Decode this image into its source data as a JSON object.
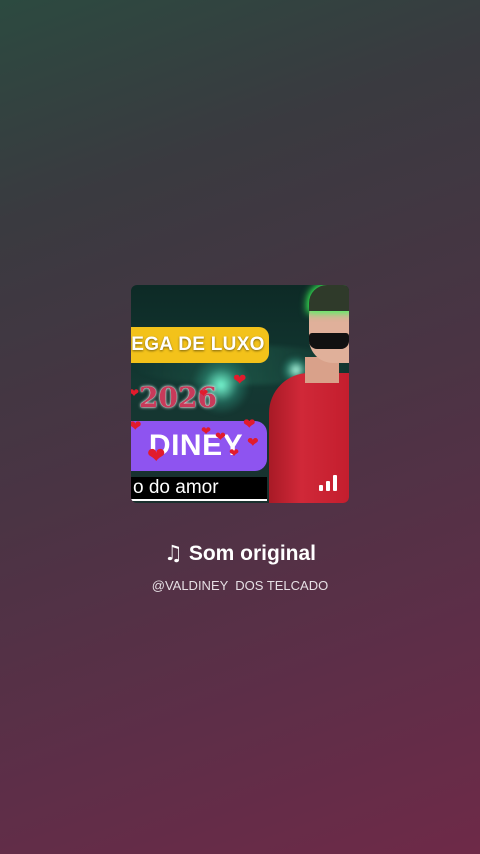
{
  "audio": {
    "icon": "music-note-icon",
    "title": "Som original",
    "author": "@VALDINEY  DOS TELCADO"
  },
  "cover": {
    "banner_top": "EGA DE LUXO",
    "year": "2026",
    "name": "DINEY",
    "subtitle": "o do  amor",
    "playing_indicator_icon": "equalizer-icon"
  },
  "colors": {
    "banner_yellow": "#f3c21a",
    "banner_purple": "#8e54f0",
    "heart_red": "#e11b2c",
    "shirt_red": "#c41e2e"
  }
}
